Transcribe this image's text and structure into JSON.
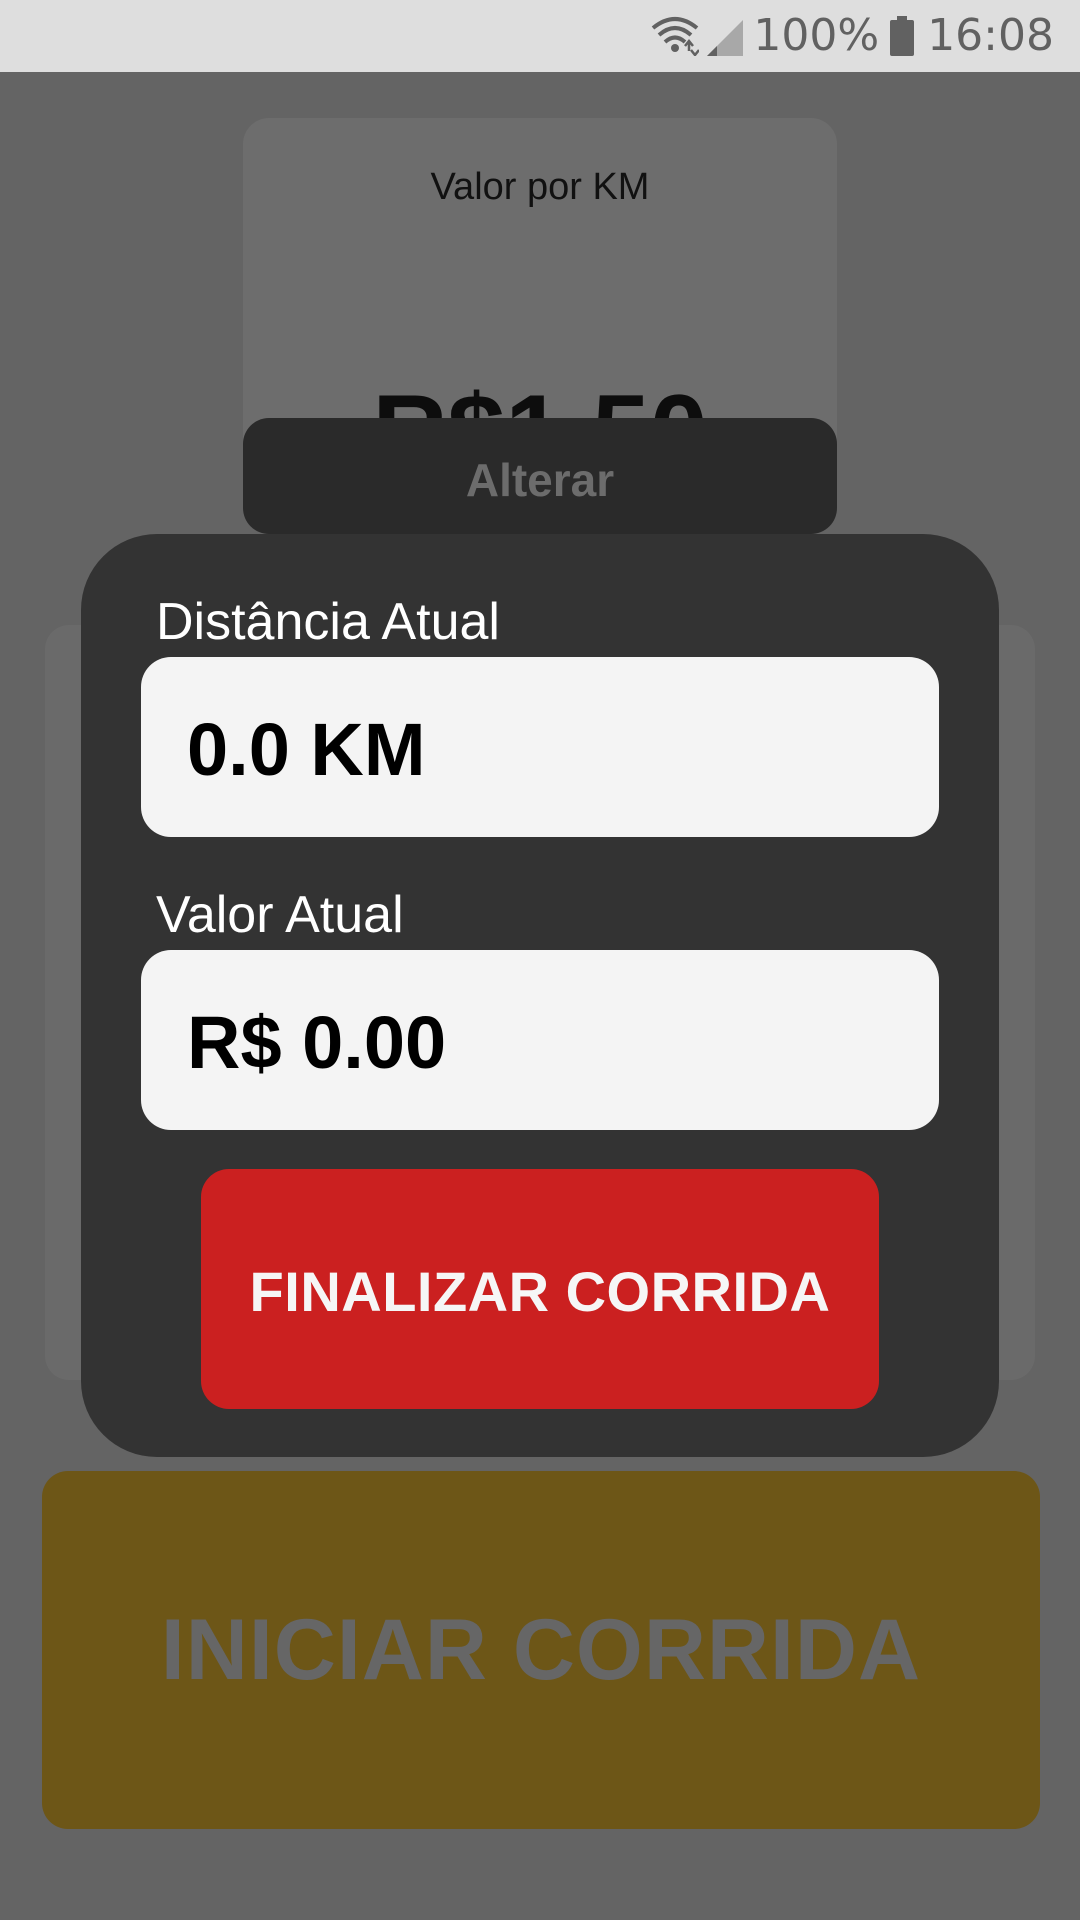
{
  "status_bar": {
    "battery_percent": "100%",
    "time": "16:08",
    "icons": [
      "wifi-icon",
      "signal-icon",
      "battery-icon"
    ]
  },
  "rate_card": {
    "label": "Valor por KM",
    "value": "R$1,50",
    "change_button": "Alterar"
  },
  "modal": {
    "distance_label": "Distância Atual",
    "distance_value": "0.0 KM",
    "fare_label": "Valor Atual",
    "fare_value": "R$ 0.00",
    "finish_button": "FINALIZAR CORRIDA"
  },
  "start_button": "INICIAR CORRIDA",
  "colors": {
    "overlay_background": "#646464",
    "modal_background": "#333333",
    "finish_button": "#cb2020",
    "start_button": "#6d5617"
  }
}
